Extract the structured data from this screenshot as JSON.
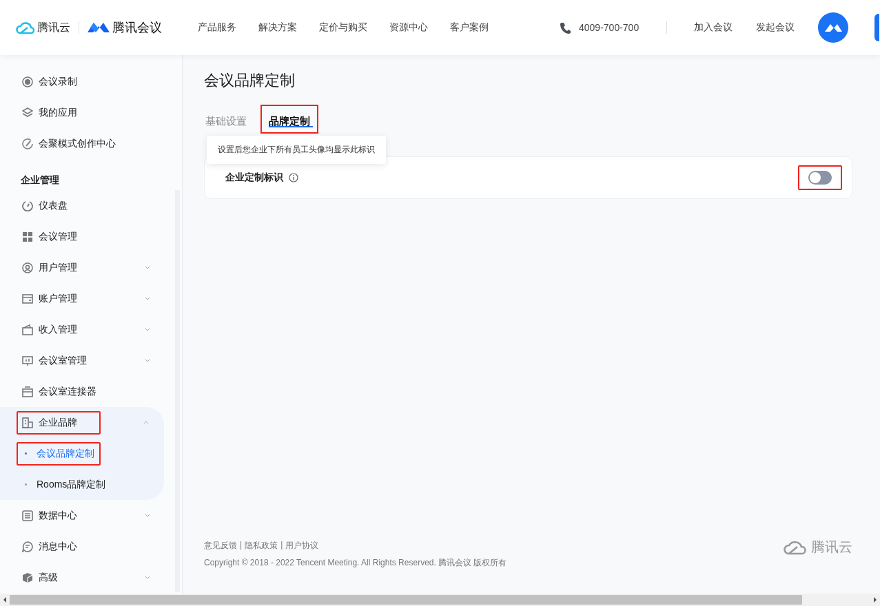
{
  "header": {
    "brand": "腾讯云",
    "product": "腾讯会议",
    "nav": [
      "产品服务",
      "解决方案",
      "定价与购买",
      "资源中心",
      "客户案例"
    ],
    "phone": "4009-700-700",
    "actions": [
      "加入会议",
      "发起会议"
    ]
  },
  "sidebar": {
    "sections": [
      {
        "items": [
          {
            "label": "会议录制",
            "selected": false,
            "highlighted": false
          },
          {
            "label": "我的应用",
            "selected": false,
            "highlighted": false
          },
          {
            "label": "会聚模式创作中心",
            "selected": false,
            "highlighted": false
          }
        ]
      },
      {
        "title": "企业管理",
        "items": [
          {
            "label": "仪表盘",
            "selected": false,
            "highlighted": false
          },
          {
            "label": "会议管理",
            "selected": false,
            "highlighted": false
          },
          {
            "label": "用户管理",
            "selected": false,
            "highlighted": false,
            "expanded": false
          },
          {
            "label": "账户管理",
            "selected": false,
            "highlighted": false,
            "expanded": false
          },
          {
            "label": "收入管理",
            "selected": false,
            "highlighted": false,
            "expanded": false
          },
          {
            "label": "会议室管理",
            "selected": false,
            "highlighted": false,
            "expanded": false
          },
          {
            "label": "会议室连接器",
            "selected": false,
            "highlighted": false
          },
          {
            "label": "企业品牌",
            "selected": false,
            "highlighted": true,
            "expanded": true,
            "children": [
              {
                "label": "会议品牌定制",
                "selected": true,
                "highlighted": true
              },
              {
                "label": "Rooms品牌定制",
                "selected": false,
                "highlighted": false
              }
            ]
          },
          {
            "label": "数据中心",
            "selected": false,
            "highlighted": false,
            "expanded": false
          },
          {
            "label": "消息中心",
            "selected": false,
            "highlighted": false
          },
          {
            "label": "高级",
            "selected": false,
            "highlighted": false,
            "expanded": false
          }
        ]
      }
    ]
  },
  "page": {
    "title": "会议品牌定制",
    "tabs": [
      {
        "label": "基础设置",
        "selected": false,
        "highlighted": false
      },
      {
        "label": "品牌定制",
        "selected": true,
        "highlighted": true
      }
    ],
    "tooltip": "设置后您企业下所有员工头像均显示此标识",
    "settings": [
      {
        "label": "企业定制标识",
        "on": false,
        "highlighted": true
      }
    ]
  },
  "footer": {
    "links": [
      "意见反馈",
      "隐私政策",
      "用户协议"
    ],
    "separator": "|",
    "copyright": "Copyright © 2018 - 2022 Tencent Meeting. All Rights Reserved. 腾讯会议 版权所有",
    "logo_text": "腾讯云"
  }
}
